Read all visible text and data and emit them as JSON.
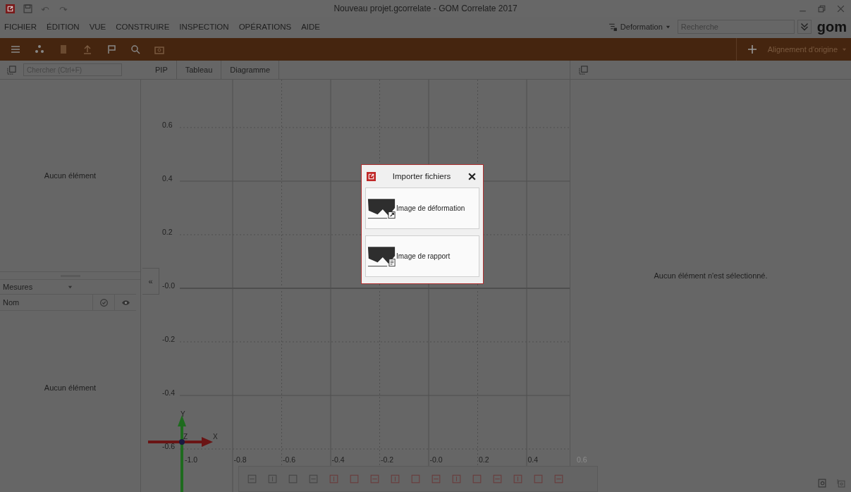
{
  "window": {
    "title": "Nouveau projet.gcorrelate - GOM Correlate 2017"
  },
  "menu": [
    "FICHIER",
    "ÉDITION",
    "VUE",
    "CONSTRUIRE",
    "INSPECTION",
    "OPÉRATIONS",
    "AIDE"
  ],
  "workspace": {
    "label": "Deformation"
  },
  "search": {
    "placeholder": "Recherche"
  },
  "logo": "gom",
  "toolbar": {
    "alignment": "Alignement d'origine"
  },
  "left_panel": {
    "search_placeholder": "Chercher (Ctrl+F)",
    "empty_top": "Aucun élément",
    "dropdown": "Mesures",
    "column": "Nom",
    "empty_bottom": "Aucun élément"
  },
  "collapse_button": "«",
  "view_tabs": [
    "PIP",
    "Tableau",
    "Diagramme"
  ],
  "viewport": {
    "y_labels": [
      "0.6",
      "0.4",
      "0.2",
      "-0.0",
      "-0.2",
      "-0.4",
      "-0.6"
    ],
    "x_labels": [
      "-1.0",
      "-0.8",
      "-0.6",
      "-0.4",
      "-0.2",
      "-0.0",
      "0.2",
      "0.4",
      "0.6"
    ],
    "axes": {
      "x": "X",
      "y": "Y",
      "z": "Z"
    }
  },
  "right_panel": {
    "message": "Aucun élément n'est sélectionné."
  },
  "dialog": {
    "title": "Importer fichiers",
    "options": [
      {
        "label": "Image de déformation",
        "kind": "deformation"
      },
      {
        "label": "Image de rapport",
        "kind": "report"
      }
    ]
  }
}
